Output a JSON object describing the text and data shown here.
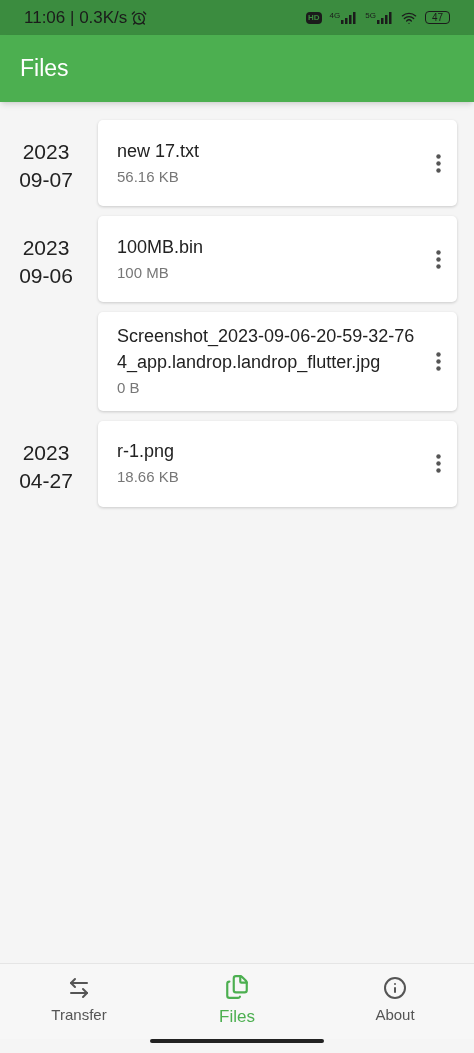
{
  "status_bar": {
    "time": "11:06 | 0.3K/s",
    "hd": "HD",
    "network_1": "4G",
    "network_2": "5G",
    "battery": "47"
  },
  "app_bar": {
    "title": "Files"
  },
  "groups": [
    {
      "year": "2023",
      "day": "09-07",
      "files": [
        {
          "name": "new 17.txt",
          "size": "56.16 KB"
        }
      ]
    },
    {
      "year": "2023",
      "day": "09-06",
      "files": [
        {
          "name": "100MB.bin",
          "size": "100 MB"
        },
        {
          "name": "Screenshot_2023-09-06-20-59-32-764_app.landrop.landrop_flutter.jpg",
          "size": "0 B"
        }
      ]
    },
    {
      "year": "2023",
      "day": "04-27",
      "files": [
        {
          "name": "r-1.png",
          "size": "18.66 KB"
        }
      ]
    }
  ],
  "nav": [
    {
      "kind": "transfer",
      "label": "Transfer",
      "selected": false
    },
    {
      "kind": "files",
      "label": "Files",
      "selected": true
    },
    {
      "kind": "about",
      "label": "About",
      "selected": false
    }
  ]
}
